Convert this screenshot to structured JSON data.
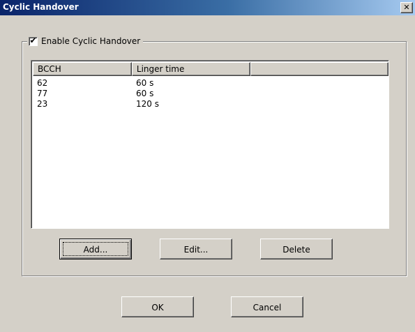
{
  "window": {
    "title": "Cyclic Handover",
    "close_glyph": "✕"
  },
  "group": {
    "label": "Enable Cyclic Handover",
    "checked": true,
    "check_glyph": "✔"
  },
  "list": {
    "columns": [
      "BCCH",
      "Linger time",
      ""
    ],
    "rows": [
      {
        "bcch": "62",
        "linger": "60 s"
      },
      {
        "bcch": "77",
        "linger": "60 s"
      },
      {
        "bcch": "23",
        "linger": "120 s"
      }
    ]
  },
  "buttons": {
    "add": "Add...",
    "edit": "Edit...",
    "delete": "Delete",
    "ok": "OK",
    "cancel": "Cancel"
  },
  "colors": {
    "title_start": "#0a246a",
    "title_end": "#a6caf0",
    "face": "#d4d0c8"
  }
}
